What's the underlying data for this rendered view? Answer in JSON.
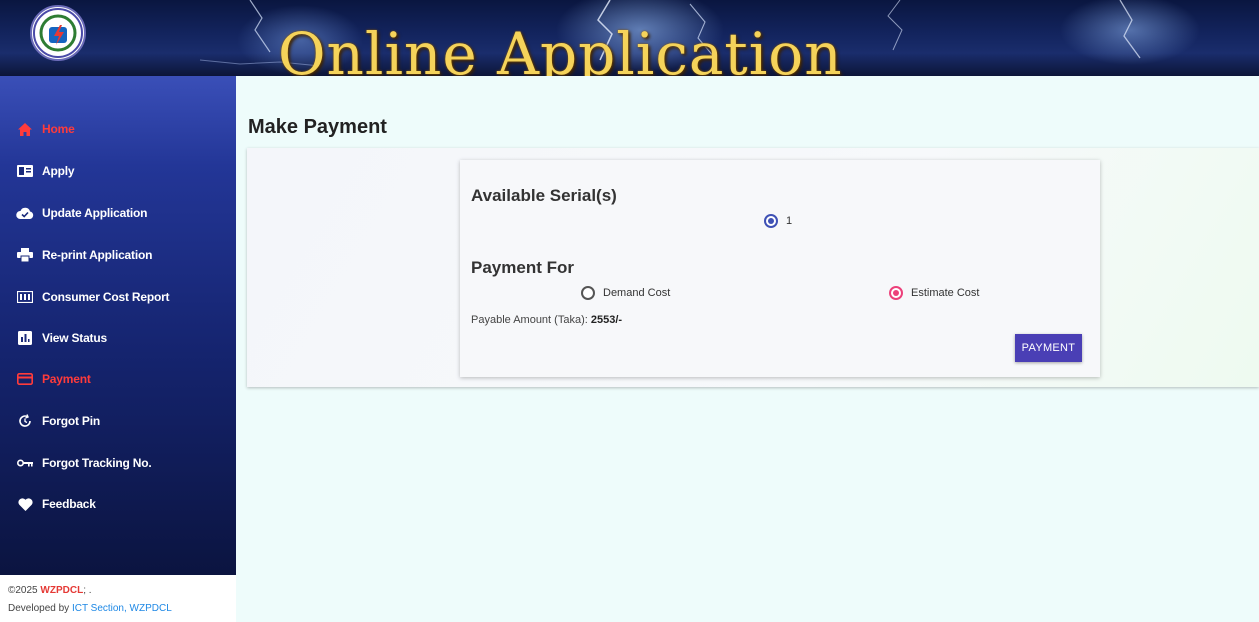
{
  "banner": {
    "title": "Online Application"
  },
  "sidebar": {
    "items": [
      {
        "label": "Home",
        "icon": "home-icon",
        "active": false
      },
      {
        "label": "Apply",
        "icon": "form-icon",
        "active": false
      },
      {
        "label": "Update Application",
        "icon": "cloud-check-icon",
        "active": false
      },
      {
        "label": "Re-print Application",
        "icon": "printer-icon",
        "active": false
      },
      {
        "label": "Consumer Cost Report",
        "icon": "report-icon",
        "active": false
      },
      {
        "label": "View Status",
        "icon": "bar-chart-icon",
        "active": false
      },
      {
        "label": "Payment",
        "icon": "credit-card-icon",
        "active": true
      },
      {
        "label": "Forgot Pin",
        "icon": "refresh-icon",
        "active": false
      },
      {
        "label": "Forgot Tracking No.",
        "icon": "key-icon",
        "active": false
      },
      {
        "label": "Feedback",
        "icon": "heart-icon",
        "active": false
      }
    ],
    "accent_color": "#ff3b3b"
  },
  "footer": {
    "copyright": "©2025 ",
    "org": "WZPDCL",
    "suffix": "; .",
    "developed_by": "Developed by ",
    "section": "ICT Section, WZPDCL"
  },
  "main": {
    "page_title": "Make Payment",
    "serials": {
      "heading": "Available Serial(s)",
      "options": [
        {
          "label": "1",
          "selected": true
        }
      ]
    },
    "payment_for": {
      "heading": "Payment For",
      "options": [
        {
          "label": "Demand Cost",
          "selected": false
        },
        {
          "label": "Estimate Cost",
          "selected": true
        }
      ]
    },
    "payable": {
      "label": "Payable Amount (Taka): ",
      "amount": "2553/-"
    },
    "payment_button": "PAYMENT",
    "button_color": "#4a3fb5"
  }
}
